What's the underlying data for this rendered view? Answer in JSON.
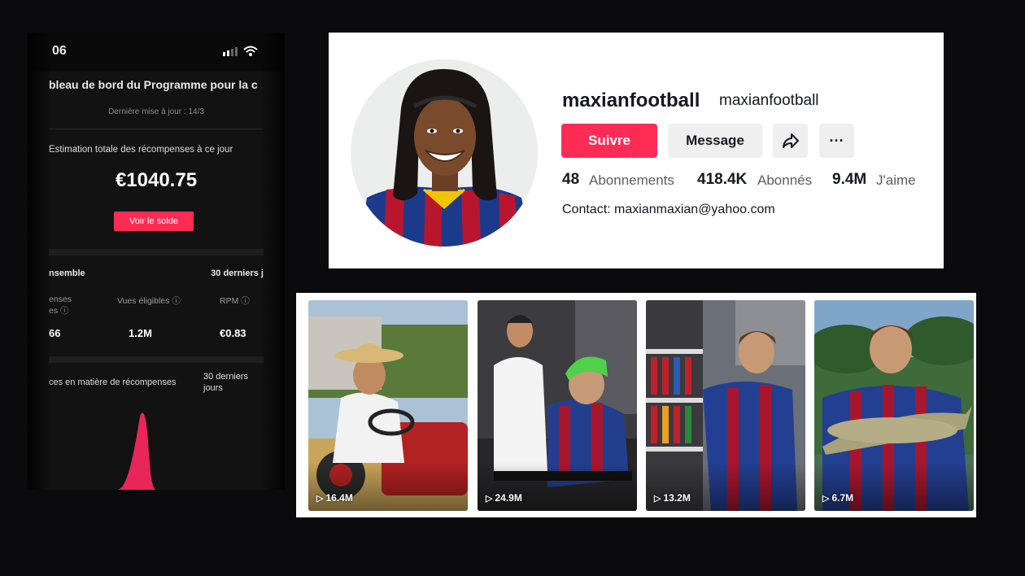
{
  "phone": {
    "status_time": "06",
    "status_icons": "▪▫ ⌔",
    "header_title": "bleau de bord du Programme pour la c",
    "last_update": "Dernière mise à jour : 14/3",
    "estimate_label": "Estimation totale des récompenses à ce jour",
    "estimate_amount": "€1040.75",
    "balance_button": "Voir le solde",
    "summary_left": "nsemble",
    "summary_right": "30 derniers j",
    "columns": [
      {
        "label": "enses\nes ⓘ",
        "value": "66"
      },
      {
        "label": "Vues éligibles ⓘ",
        "value": "1.2M"
      },
      {
        "label": "RPM ⓘ",
        "value": "€0.83"
      }
    ],
    "performance_label": "ces en matière de récompenses",
    "performance_period": "30 derniers jours",
    "chart_accent": "#e8265a"
  },
  "profile": {
    "username": "maxianfootball",
    "nickname": "maxianfootball",
    "follow_label": "Suivre",
    "message_label": "Message",
    "share_icon": "share-icon",
    "more_icon": "more-icon",
    "more_glyph": "···",
    "stats": [
      {
        "value": "48",
        "label": "Abonnements"
      },
      {
        "value": "418.4K",
        "label": "Abonnés"
      },
      {
        "value": "9.4M",
        "label": "J'aime"
      }
    ],
    "contact": "Contact: maxianmaxian@yahoo.com",
    "accent": "#fe2c55"
  },
  "videos": [
    {
      "views": "16.4M",
      "play_icon": "▷"
    },
    {
      "views": "24.9M",
      "play_icon": "▷"
    },
    {
      "views": "13.2M",
      "play_icon": "▷"
    },
    {
      "views": "6.7M",
      "play_icon": "▷"
    }
  ]
}
